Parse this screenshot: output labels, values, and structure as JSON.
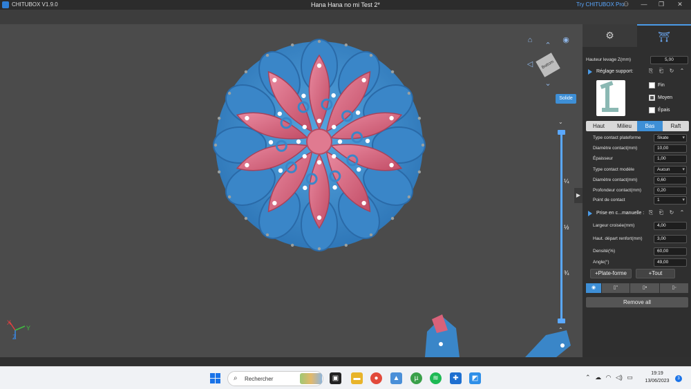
{
  "titlebar": {
    "app_name": "CHITUBOX V1.9.0",
    "document_title": "Hana Hana no mi Test 2*",
    "promo": "Try CHITUBOX Pro",
    "icons": [
      "user-icon",
      "minimize-icon",
      "maximize-icon",
      "close-icon"
    ]
  },
  "viewport": {
    "view_cube_label": "Bottom",
    "display_mode": "Solide",
    "axes": {
      "x": "X",
      "y": "Y",
      "z": "Z"
    },
    "slider_marks": [
      "¼",
      "½",
      "¾"
    ]
  },
  "panel": {
    "tabs": [
      "settings-tab",
      "supports-tab"
    ],
    "lift_height_label": "Hauteur levage Z(mm)",
    "lift_height_value": "5,00",
    "support_section_title": "Réglage support:",
    "density_options": [
      {
        "label": "Fin",
        "checked": false
      },
      {
        "label": "Moyen",
        "checked": true
      },
      {
        "label": "Épais",
        "checked": false
      }
    ],
    "subtabs": [
      "Haut",
      "Milieu",
      "Bas",
      "Raft"
    ],
    "active_subtab": "Bas",
    "bottom_settings": [
      {
        "label": "Type contact plateforme",
        "value": "Skate",
        "select": true
      },
      {
        "label": "Diamètre contact(mm)",
        "value": "10,00",
        "select": false
      },
      {
        "label": "Épaisseur",
        "value": "1,00",
        "select": false
      },
      {
        "label": "Type contact modèle",
        "value": "Aucun",
        "select": true
      },
      {
        "label": "Diamètre contact(mm)",
        "value": "0,60",
        "select": false
      },
      {
        "label": "Profondeur contact(mm)",
        "value": "0,20",
        "select": false
      },
      {
        "label": "Point de contact",
        "value": "1",
        "select": true
      }
    ],
    "manual_section_title": "Prise en c...manuelle :",
    "manual_settings": [
      {
        "label": "Largeur croisée(mm)",
        "value": "4,00"
      },
      {
        "label": "Haut. départ renfort(mm)",
        "value": "3,00"
      },
      {
        "label": "Densité(%)",
        "value": "60,00"
      },
      {
        "label": "Angle(°)",
        "value": "49,00"
      }
    ],
    "add_platform": "+Plate-forme",
    "add_all": "+Tout",
    "remove_all": "Remove all"
  },
  "taskbar": {
    "search_placeholder": "Rechercher",
    "time": "19:19",
    "date": "13/06/2023",
    "notifications": "3"
  },
  "colors": {
    "accent": "#3e8fd6",
    "model_blue": "#3b8fd0",
    "model_pink": "#d9627a"
  }
}
